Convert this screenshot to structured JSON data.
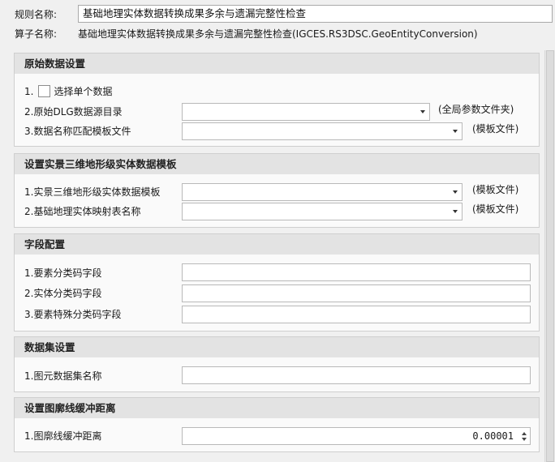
{
  "header": {
    "rule_name_label": "规则名称:",
    "rule_name_value": "基础地理实体数据转换成果多余与遗漏完整性检查",
    "operator_label": "算子名称:",
    "operator_value": "基础地理实体数据转换成果多余与遗漏完整性检查(IGCES.RS3DSC.GeoEntityConversion)"
  },
  "sections": {
    "raw_data": {
      "title": "原始数据设置",
      "single_prefix": "1.",
      "single_label": "选择单个数据",
      "single_checked": false,
      "dlg_label": "2.原始DLG数据源目录",
      "dlg_value": "",
      "dlg_suffix": "(全局参数文件夹)",
      "template_label": "3.数据名称匹配模板文件",
      "template_value": "",
      "template_suffix": "(模板文件)"
    },
    "entity_template": {
      "title": "设置实景三维地形级实体数据模板",
      "template_label": "1.实景三维地形级实体数据模板",
      "template_value": "",
      "template_suffix": "(模板文件)",
      "mapping_label": "2.基础地理实体映射表名称",
      "mapping_value": "",
      "mapping_suffix": "(模板文件)"
    },
    "fields": {
      "title": "字段配置",
      "feature_code_label": "1.要素分类码字段",
      "feature_code_value": "",
      "entity_code_label": "2.实体分类码字段",
      "entity_code_value": "",
      "special_code_label": "3.要素特殊分类码字段",
      "special_code_value": ""
    },
    "dataset": {
      "title": "数据集设置",
      "name_label": "1.图元数据集名称",
      "name_value": ""
    },
    "buffer": {
      "title": "设置图廓线缓冲距离",
      "distance_label": "1.图廓线缓冲距离",
      "distance_value": "0.00001"
    }
  }
}
